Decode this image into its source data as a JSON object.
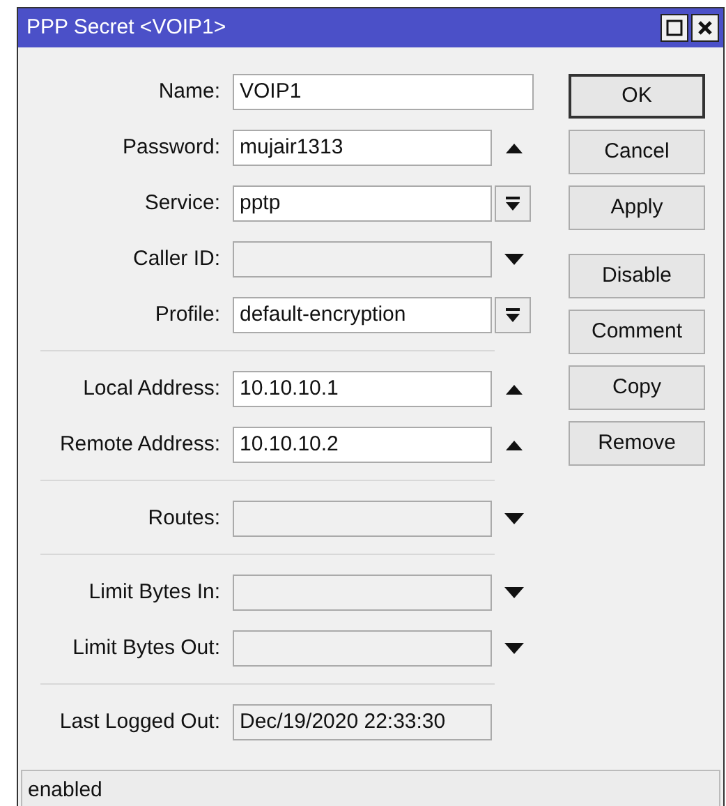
{
  "window": {
    "title": "PPP Secret <VOIP1>"
  },
  "sections": [
    {
      "fields": [
        {
          "label": "Name:",
          "value": "VOIP1",
          "kind": "wide"
        },
        {
          "label": "Password:",
          "value": "mujair1313",
          "kind": "up"
        },
        {
          "label": "Service:",
          "value": "pptp",
          "kind": "select"
        },
        {
          "label": "Caller ID:",
          "kind": "down"
        },
        {
          "label": "Profile:",
          "value": "default-encryption",
          "kind": "select"
        }
      ]
    },
    {
      "fields": [
        {
          "label": "Local Address:",
          "value": "10.10.10.1",
          "kind": "up"
        },
        {
          "label": "Remote Address:",
          "value": "10.10.10.2",
          "kind": "up"
        }
      ]
    },
    {
      "fields": [
        {
          "label": "Routes:",
          "kind": "down"
        }
      ]
    },
    {
      "fields": [
        {
          "label": "Limit Bytes In:",
          "kind": "down"
        },
        {
          "label": "Limit Bytes Out:",
          "kind": "down"
        }
      ]
    },
    {
      "fields": [
        {
          "label": "Last Logged Out:",
          "value": "Dec/19/2020 22:33:30",
          "kind": "readonly"
        }
      ]
    }
  ],
  "button_groups": [
    {
      "buttons": [
        {
          "label": "OK",
          "default": true
        },
        {
          "label": "Cancel",
          "default": false
        },
        {
          "label": "Apply",
          "default": false
        }
      ]
    },
    {
      "buttons": [
        {
          "label": "Disable",
          "default": false
        },
        {
          "label": "Comment",
          "default": false
        },
        {
          "label": "Copy",
          "default": false
        },
        {
          "label": "Remove",
          "default": false
        }
      ]
    }
  ],
  "status_bar": {
    "text": "enabled"
  }
}
